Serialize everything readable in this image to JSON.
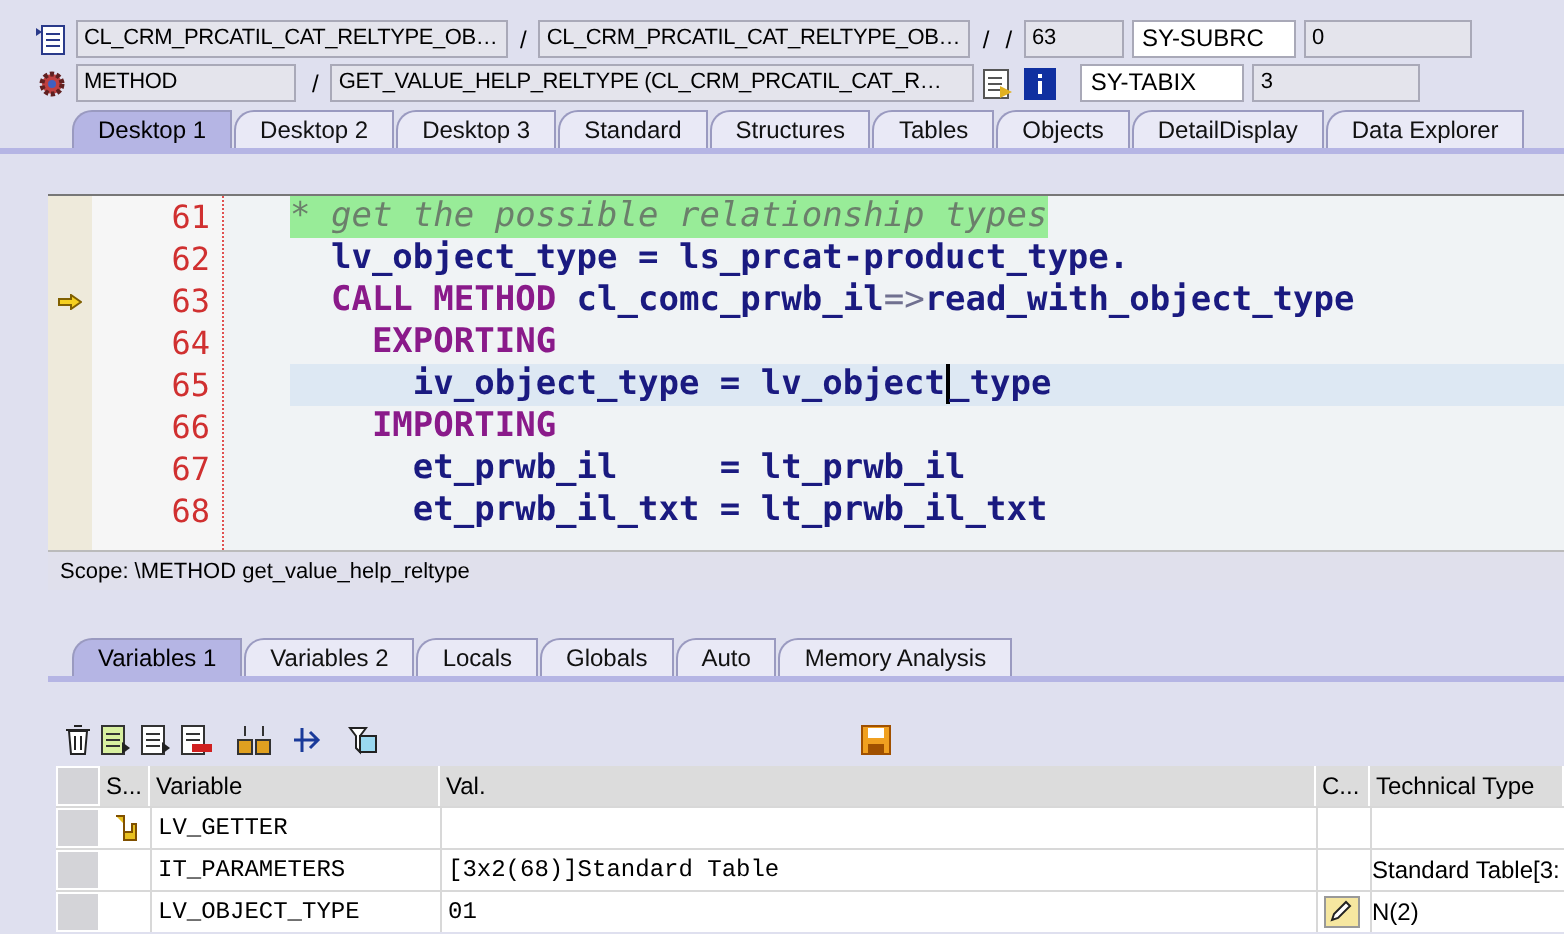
{
  "header": {
    "row1": {
      "program": "CL_CRM_PRCATIL_CAT_RELTYPE_OB…",
      "include": "CL_CRM_PRCATIL_CAT_RELTYPE_OB…",
      "line": "63",
      "field": "SY-SUBRC",
      "value": "0"
    },
    "row2": {
      "event_type": "METHOD",
      "event": "GET_VALUE_HELP_RELTYPE (CL_CRM_PRCATIL_CAT_R…",
      "field": "SY-TABIX",
      "value": "3"
    },
    "separators": [
      "/",
      "/",
      "/",
      "/"
    ]
  },
  "desktop_tabs": [
    {
      "label": "Desktop 1",
      "selected": true
    },
    {
      "label": "Desktop 2",
      "selected": false
    },
    {
      "label": "Desktop 3",
      "selected": false
    },
    {
      "label": "Standard",
      "selected": false
    },
    {
      "label": "Structures",
      "selected": false
    },
    {
      "label": "Tables",
      "selected": false
    },
    {
      "label": "Objects",
      "selected": false
    },
    {
      "label": "DetailDisplay",
      "selected": false
    },
    {
      "label": "Data Explorer",
      "selected": false
    }
  ],
  "code": [
    {
      "number": "61",
      "kind": "comment",
      "current": false,
      "segments": [
        {
          "kind": "comment",
          "text": "* get the possible relationship types"
        }
      ]
    },
    {
      "number": "62",
      "kind": "normal",
      "current": false,
      "segments": [
        {
          "kind": "ident",
          "text": "  lv_object_type = ls_prcat-product_type."
        }
      ]
    },
    {
      "number": "63",
      "kind": "normal",
      "current": true,
      "segments": [
        {
          "kind": "keyword",
          "text": "  CALL METHOD "
        },
        {
          "kind": "ident",
          "text": "cl_comc_prwb_il"
        },
        {
          "kind": "operator",
          "text": "=>"
        },
        {
          "kind": "ident",
          "text": "read_with_object_type"
        }
      ]
    },
    {
      "number": "64",
      "kind": "normal",
      "current": false,
      "segments": [
        {
          "kind": "keyword",
          "text": "    EXPORTING"
        }
      ]
    },
    {
      "number": "65",
      "kind": "cursor",
      "current": false,
      "segments": [
        {
          "kind": "ident",
          "text": "      iv_object_type = lv_object"
        },
        {
          "kind": "ident",
          "text": "_type"
        }
      ]
    },
    {
      "number": "66",
      "kind": "normal",
      "current": false,
      "segments": [
        {
          "kind": "keyword",
          "text": "    IMPORTING"
        }
      ]
    },
    {
      "number": "67",
      "kind": "normal",
      "current": false,
      "segments": [
        {
          "kind": "ident",
          "text": "      et_prwb_il     = lt_prwb_il"
        }
      ]
    },
    {
      "number": "68",
      "kind": "normal",
      "current": false,
      "segments": [
        {
          "kind": "ident",
          "text": "      et_prwb_il_txt = lt_prwb_il_txt"
        }
      ]
    }
  ],
  "scope": "Scope: \\METHOD get_value_help_reltype",
  "variable_tabs": [
    {
      "label": "Variables 1",
      "selected": true
    },
    {
      "label": "Variables 2",
      "selected": false
    },
    {
      "label": "Locals",
      "selected": false
    },
    {
      "label": "Globals",
      "selected": false
    },
    {
      "label": "Auto",
      "selected": false
    },
    {
      "label": "Memory Analysis",
      "selected": false
    }
  ],
  "table": {
    "columns": [
      "S...",
      "Variable",
      "Val.",
      "C...",
      "Technical Type"
    ],
    "rows": [
      {
        "status_icon": true,
        "variable": "LV_GETTER",
        "value": "",
        "technical_type": ""
      },
      {
        "status_icon": false,
        "variable": "IT_PARAMETERS",
        "value": "[3x2(68)]Standard Table",
        "technical_type": "Standard Table[3:"
      },
      {
        "status_icon": false,
        "variable": "LV_OBJECT_TYPE",
        "value": "01",
        "technical_type": "N(2)"
      }
    ]
  }
}
